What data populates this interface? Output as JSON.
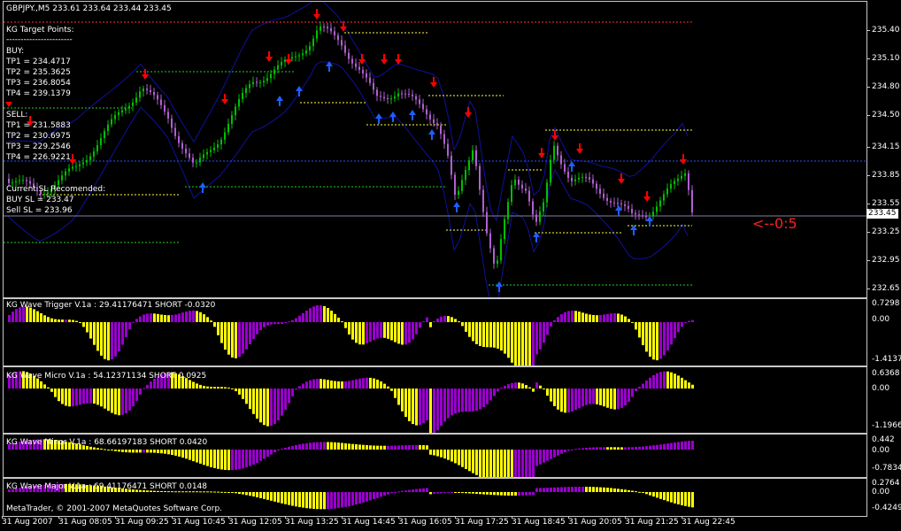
{
  "main": {
    "symbol_header": "GBPJPY.,M5  233.61 233.64 233.44 233.45",
    "target_title": "KG Target Points:",
    "target_divider": "-----------------------",
    "buy_label": "BUY:",
    "buy_tp": [
      "TP1 = 234.4717",
      "TP2 = 235.3625",
      "TP3 = 236.8054",
      "TP4 = 239.1379"
    ],
    "sell_label": "SELL:",
    "sell_tp": [
      "TP1 = 231.5883",
      "TP2 = 230.6975",
      "TP3 = 229.2546",
      "TP4 = 226.9221"
    ],
    "sl_title": "Current SL Recomended:",
    "buy_sl": "BUY  SL  = 233.47",
    "sell_sl": "Sell   SL  = 233.96",
    "countdown": "<--0:5",
    "current_price": "233.45",
    "price_ticks": [
      "235.40",
      "235.10",
      "234.80",
      "234.50",
      "234.15",
      "233.85",
      "233.55",
      "233.25",
      "232.95",
      "232.65"
    ]
  },
  "indicators": [
    {
      "label": "KG Wave Trigger V.1a : 29.41176471 SHORT -0.0320",
      "ticks": [
        "0.7298",
        "0.00",
        "-1.4137"
      ]
    },
    {
      "label": "KG Wave Micro V.1a : 54.12371134 SHORT 0.0925",
      "ticks": [
        "0.6368",
        "0.00",
        "-1.1966"
      ]
    },
    {
      "label": "KG Wave Minor V.1a : 68.66197183 SHORT 0.0420",
      "ticks": [
        "0.442",
        "0.00",
        "-0.7834"
      ]
    },
    {
      "label": "KG Wave Major V.1a : 69.41176471 SHORT 0.0148",
      "ticks": [
        "0.2764",
        "0.00",
        "-0.4249"
      ]
    }
  ],
  "copyright": "MetaTrader, © 2001-2007 MetaQuotes Software Corp.",
  "time_axis": [
    "31 Aug 2007",
    "31 Aug 08:05",
    "31 Aug 09:25",
    "31 Aug 10:45",
    "31 Aug 12:05",
    "31 Aug 13:25",
    "31 Aug 14:45",
    "31 Aug 16:05",
    "31 Aug 17:25",
    "31 Aug 18:45",
    "31 Aug 20:05",
    "31 Aug 21:25",
    "31 Aug 22:45"
  ],
  "colors": {
    "bull": "#00c000",
    "bear": "#b060d0",
    "hist_purple": "#9900cc",
    "hist_yellow": "#ffff00",
    "arrow_down": "#ff0000",
    "arrow_up": "#1e5fff",
    "band": "#1010a0",
    "level_green": "#20d020",
    "level_yellow": "#ffff40",
    "level_red": "#ff3030",
    "level_blue": "#3050ff"
  }
}
